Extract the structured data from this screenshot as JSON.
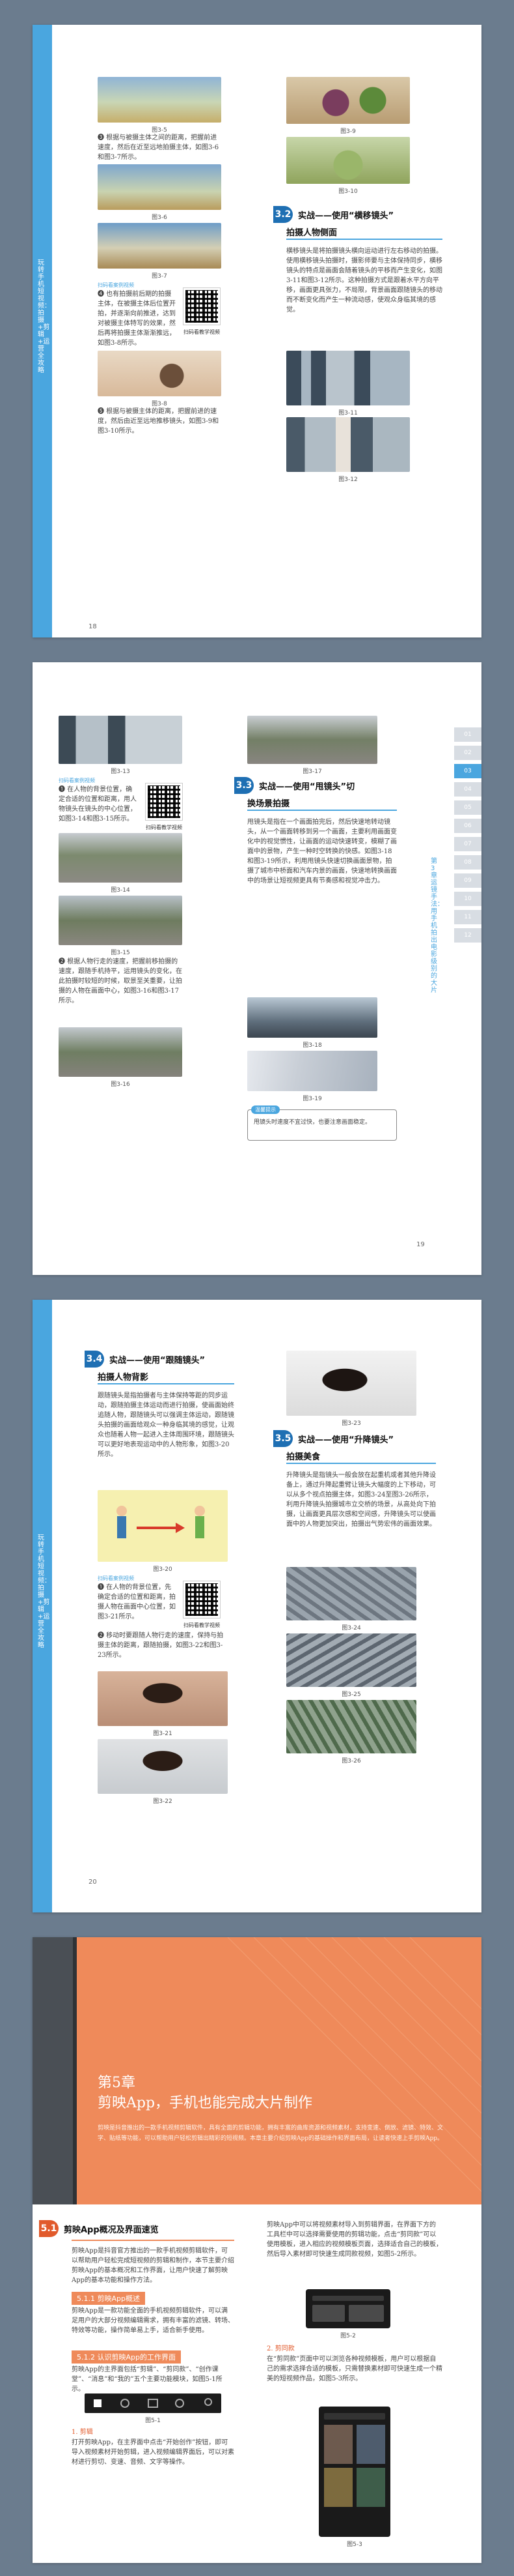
{
  "page1": {
    "side_text": "玩转手机短视频：拍摄+剪辑+运营全攻略",
    "captions": [
      "图3-5",
      "图3-6",
      "图3-7",
      "图3-8",
      "图3-9",
      "图3-10",
      "图3-11",
      "图3-12"
    ],
    "step3": "❸ 根据与被摄主体之间的距离，把握前进速度，然后在近至远地拍摄主体，如图3-6和图3-7所示。",
    "scan_label": "扫码看案例视频",
    "scan_text": "❹ 也有拍摄前后期的拍摄主体，在被摄主体后位置开拍，并逐渐向前推进，达到对被摄主体特写的效果，然后再将拍摄主体渐渐推远，如图3-8所示。",
    "qr_caption": "扫码看教学视频",
    "step5": "❺ 根据与被摄主体的距离，把握前进的速度，然后由近至远地推移镜头，如图3-9和图3-10所示。",
    "sec_num": "3.2",
    "sec_title": "实战——使用“横移镜头”",
    "sec_title_2": "拍摄人物侧面",
    "sec_body": "横移镜头是将拍摄镜头横向运动进行左右移动的拍摄。使用横移镜头拍摄时，摄影师要与主体保持同步，横移镜头的特点是画面会随着镜头的平移而产生变化，如图3-11和图3-12所示。这种拍摄方式是跟着水平方向平移，画面更具张力，不局限，背景画面跟随镜头的移动而不断变化而产生一种流动感，使观众身临其境的感觉。",
    "page_number": "18"
  },
  "page2": {
    "tabs": [
      "01",
      "02",
      "03",
      "04",
      "05",
      "06",
      "07",
      "08",
      "09",
      "10",
      "11",
      "12"
    ],
    "active_tab": "03",
    "side_text": "第3章 运镜手法：用手机拍出电影级别的大片",
    "captions": [
      "图3-13",
      "图3-14",
      "图3-15",
      "图3-16",
      "图3-17",
      "图3-18",
      "图3-19"
    ],
    "scan_title": "扫码看案例视频",
    "step1": "❶ 在人物的背景位置，确定合适的位置和距离，用人物镜头在镜头的中心位置，如图3-14和图3-15所示。",
    "qr_caption": "扫码看教学视频",
    "step2": "❷ 根据人物行走的速度，把握前移拍摄的速度，跟随手机持平，运用镜头的变化，在此拍摄时较短的时候，取景至关重要，让拍摄的人物在画面中心，如图3-16和图3-17所示。",
    "sec_num": "3.3",
    "sec_title": "实战——使用“甩镜头”切",
    "sec_title_2": "换场景拍摄",
    "sec_body": "甩镜头是指在一个画面拍完后，然后快速地转动镜头，从一个画面转移到另一个画面，主要利用画面变化中的视觉惯性，让画面的运动快速转变，模糊了画面中的景物，产生一种时空转换的快感。如图3-18和图3-19所示，利用甩镜头快速切换画面景物，拍摄了城市中桥面和汽车内景的画面，快速地转换画面中的场景让短视频更具有节奏感和视觉冲击力。",
    "note_tag": "温馨提示",
    "note_text": "甩镜头时速度不宜过快，也要注意画面稳定。",
    "page_number": "19"
  },
  "page3": {
    "side_text": "玩转手机短视频：拍摄+剪辑+运营全攻略",
    "sec1_num": "3.4",
    "sec1_title": "实战——使用“跟随镜头”",
    "sec1_title_2": "拍摄人物背影",
    "sec1_body": "跟随镜头是指拍摄者与主体保持等距的同步运动，跟随拍摄主体运动而进行拍摄，使画面始终追随人物，跟随镜头可以强调主体运动，跟随镜头拍摄的画面给观众一种身临其境的感觉，让观众也随着人物一起进入主体周围环境，跟随镜头可以更好地表现运动中的人物形象，如图3-20所示。",
    "captions": [
      "图3-20",
      "图3-21",
      "图3-22",
      "图3-23",
      "图3-24",
      "图3-25",
      "图3-26"
    ],
    "scan_title": "扫码看案例视频",
    "step1": "❶ 在人物的背景位置，先确定合适的位置和距离，拍摄人物在画面中心位置，如图3-21所示。",
    "qr_caption": "扫码看教学视频",
    "step2": "❷ 移动时要跟随人物行走的速度，保持与拍摄主体的距离，跟随拍摄，如图3-22和图3-23所示。",
    "sec2_num": "3.5",
    "sec2_title": "实战——使用“升降镜头”",
    "sec2_title_2": "拍摄美食",
    "sec2_body": "升降镜头是指镜头一般会放在起重机或者其他升降设备上，通过升降起重臂让镜头大幅度的上下移动，可以从多个视点拍摄主体，如图3-24至图3-26所示，利用升降镜头拍摄城市立交桥的场景，从高处向下拍摄，让画面更具层次感和空间感，升降镜头可以使画面中的人物更加突出，拍摄出气势宏伟的画面效果。",
    "page_number": "20"
  },
  "page4": {
    "chapter_title_1": "第5章",
    "chapter_title_2": "剪映App，手机也能完成大片制作",
    "chapter_intro": "剪映是抖音推出的一款手机视频剪辑软件，具有全面的剪辑功能，拥有丰富的曲库资源和视频素材，支持变速、倒放、滤镜、特效、文字、贴纸等功能，可以帮助用户轻松剪辑出精彩的短视频。本章主要介绍剪映App的基础操作和界面布局，让读者快速上手剪映App。",
    "sec_num": "5.1",
    "sec_title": "剪映App概况及界面速览",
    "sec_body": "剪映App是抖音官方推出的一款手机视频剪辑软件，可以帮助用户轻松完成短视频的剪辑和制作，本节主要介绍剪映App的基本概况和工作界面，让用户快速了解剪映App的基本功能和操作方法。",
    "sub1": "5.1.1 剪映App概述",
    "sub1_body": "剪映App是一款功能全面的手机视频剪辑软件，可以满足用户的大部分视频编辑需求，拥有丰富的滤镜、转场、特效等功能，操作简单易上手，适合新手使用。",
    "sub2": "5.1.2 认识剪映App的工作界面",
    "sub2_body": "剪映App的主界面包括“剪辑”、“剪同款”、“创作课堂”、“消息”和“我的”五个主要功能模块，如图5-1所示。",
    "captions": [
      "图5-1",
      "图5-2",
      "图5-3"
    ],
    "step1_title": "1. 剪辑",
    "step1_body": "打开剪映App，在主界面中点击“开始创作”按钮，即可导入视频素材开始剪辑，进入视频编辑界面后，可以对素材进行剪切、变速、音频、文字等操作。",
    "right_body": "剪映App中可以将视频素材导入到剪辑界面，在界面下方的工具栏中可以选择需要使用的剪辑功能，点击“剪同款”可以使用模板，进入相应的视频模板页面，选择适合自己的模板，然后导入素材即可快速生成同款视频，如图5-2所示。",
    "sub3_title": "2. 剪同款",
    "sub3_body": "在“剪同款”页面中可以浏览各种视频模板，用户可以根据自己的需求选择合适的模板，只需替换素材即可快速生成一个精美的短视频作品，如图5-3所示。"
  }
}
